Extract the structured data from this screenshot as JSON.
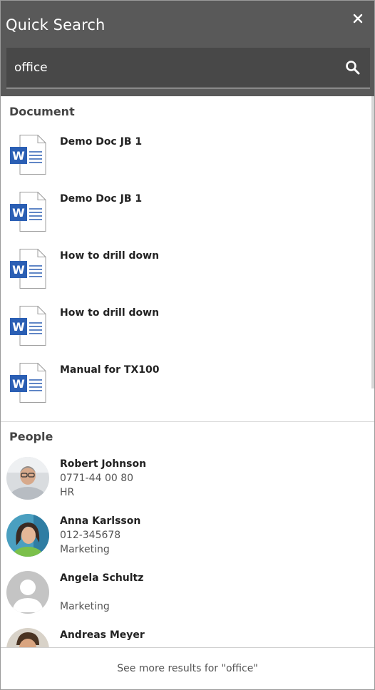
{
  "header": {
    "title": "Quick Search",
    "close_icon": "close-icon",
    "search_icon": "search-icon"
  },
  "search": {
    "value": "office"
  },
  "documents": {
    "section_title": "Document",
    "icon": "word-document-icon",
    "items": [
      {
        "name": "Demo Doc JB 1"
      },
      {
        "name": "Demo Doc JB 1"
      },
      {
        "name": "How to drill down"
      },
      {
        "name": "How to drill down"
      },
      {
        "name": "Manual for TX100"
      }
    ]
  },
  "people": {
    "section_title": "People",
    "items": [
      {
        "name": "Robert Johnson",
        "phone": "0771-44 00 80",
        "department": "HR",
        "avatar": "photo"
      },
      {
        "name": "Anna Karlsson",
        "phone": "012-345678",
        "department": "Marketing",
        "avatar": "photo"
      },
      {
        "name": "Angela Schultz",
        "phone": "",
        "department": "Marketing",
        "avatar": "default-person-icon"
      },
      {
        "name": "Andreas Meyer",
        "phone": "",
        "department": "",
        "avatar": "photo"
      }
    ]
  },
  "footer": {
    "more_results": "See more results for \"office\""
  },
  "colors": {
    "header_bg": "#595959",
    "search_bg": "#484848",
    "word_blue": "#2b5fb4"
  }
}
